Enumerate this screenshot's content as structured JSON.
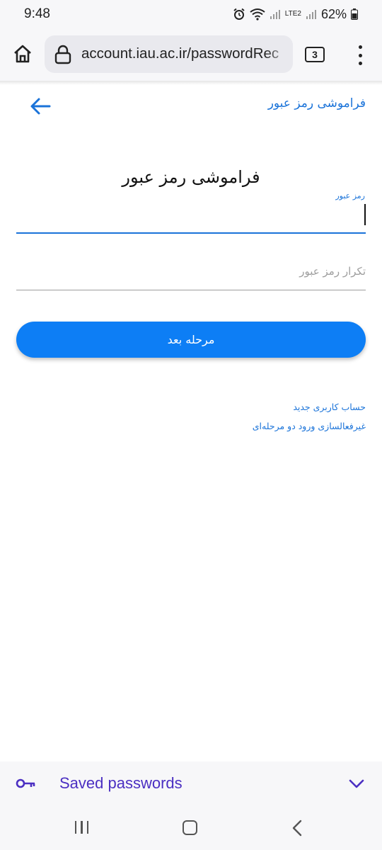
{
  "status_bar": {
    "time": "9:48",
    "battery": "62%",
    "network": "LTE2"
  },
  "browser": {
    "url": "account.iau.ac.ir/passwordRec",
    "tab_count": "3",
    "icons": [
      "home-icon",
      "lock-icon",
      "tabs-icon",
      "more-vert-icon"
    ]
  },
  "appbar": {
    "title": "فراموشی رمز عبور",
    "back_icon": "arrow-left-icon"
  },
  "form": {
    "heading": "فراموشی رمز عبور",
    "password_label": "رمز عبور",
    "password_value": "",
    "confirm_placeholder": "تکرار رمز عبور",
    "next_button": "مرحله بعد"
  },
  "links": {
    "new_account": "حساب کاربری جدید",
    "disable_2fa": "غیرفعالسازی ورود دو مرحله‌ای"
  },
  "saved_passwords": {
    "label": "Saved passwords",
    "icon": "key-icon",
    "chevron": "chevron-down-icon"
  },
  "nav": {
    "icons": [
      "recents-icon",
      "home-icon",
      "back-icon"
    ]
  },
  "colors": {
    "accent": "#1a73d9",
    "button": "#0d7ef5",
    "saved_passwords_text": "#4b2fc2"
  }
}
